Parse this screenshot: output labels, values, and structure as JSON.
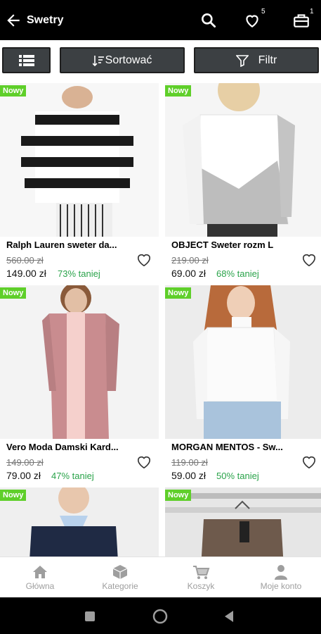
{
  "topbar": {
    "title": "Swetry",
    "favorites_count": "5",
    "cart_count": "1"
  },
  "filters": {
    "sort_label": "Sortować",
    "filter_label": "Filtr"
  },
  "products": [
    {
      "badge": "Nowy",
      "name": "Ralph Lauren sweter da...",
      "old_price": "560.00 zł",
      "price": "149.00 zł",
      "discount": "73% taniej"
    },
    {
      "badge": "Nowy",
      "name": "OBJECT Sweter rozm L",
      "old_price": "219.00 zł",
      "price": "69.00 zł",
      "discount": "68% taniej"
    },
    {
      "badge": "Nowy",
      "name": "Vero Moda Damski Kard...",
      "old_price": "149.00 zł",
      "price": "79.00 zł",
      "discount": "47% taniej"
    },
    {
      "badge": "Nowy",
      "name": "MORGAN MENTOS - Sw...",
      "old_price": "119.00 zł",
      "price": "59.00 zł",
      "discount": "50% taniej"
    },
    {
      "badge": "Nowy"
    },
    {
      "badge": "Nowy"
    }
  ],
  "bottomnav": {
    "home": "Główna",
    "categories": "Kategorie",
    "cart": "Koszyk",
    "account": "Moje konto"
  }
}
